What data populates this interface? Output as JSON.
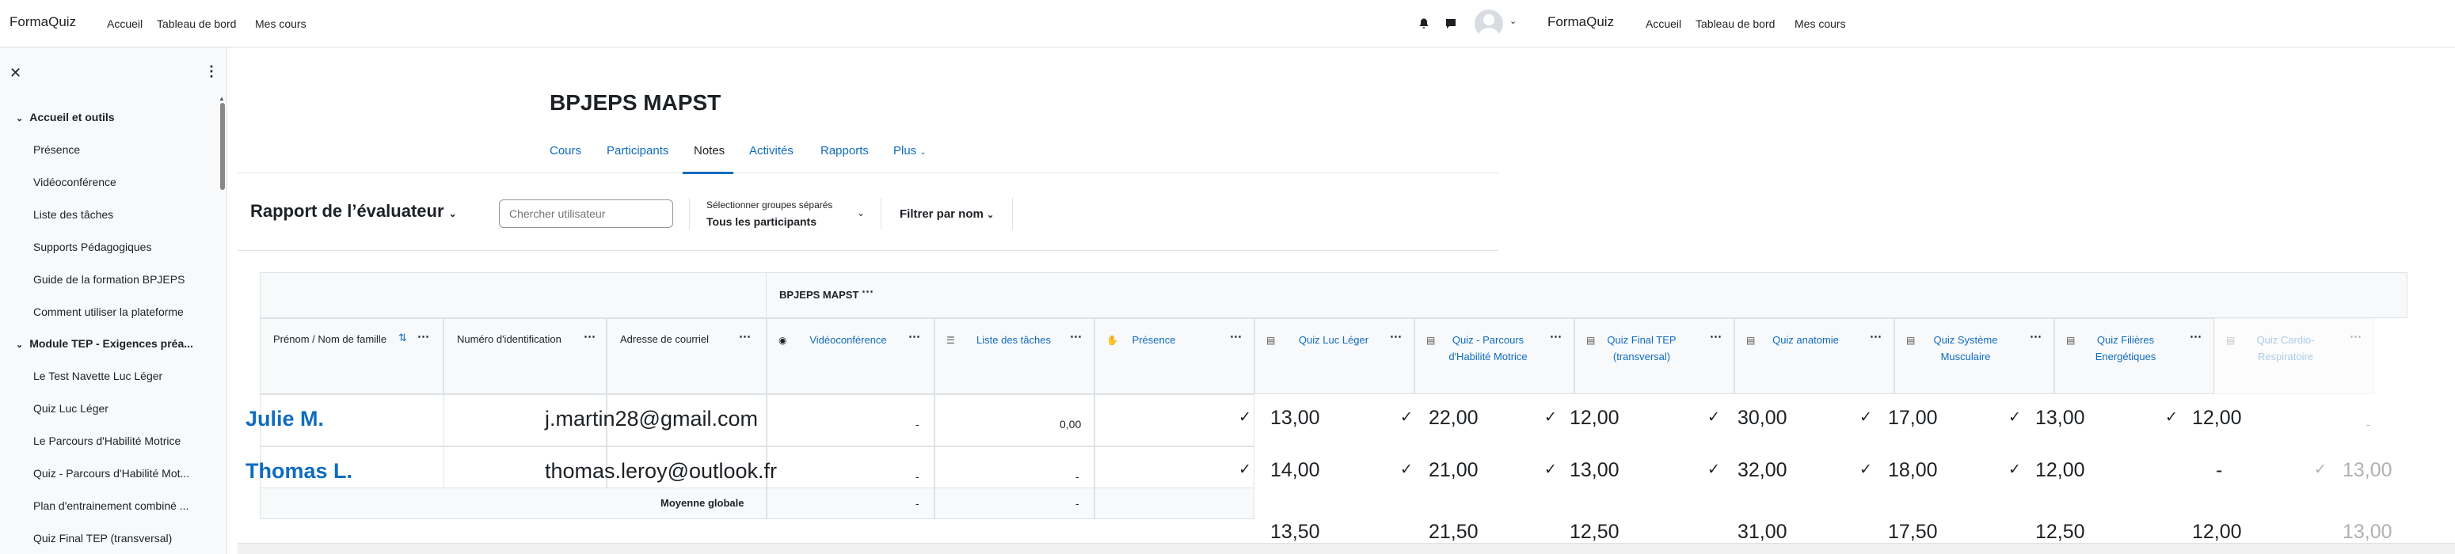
{
  "topbar": {
    "brand_left": "FormaQuiz",
    "links_left": [
      "Accueil",
      "Tableau de bord",
      "Mes cours"
    ],
    "brand_right": "FormaQuiz",
    "links_right": [
      "Accueil",
      "Tableau de bord",
      "Mes cours"
    ]
  },
  "drawer": {
    "sections": [
      {
        "label": "Accueil et outils",
        "items": [
          "Présence",
          "Vidéoconférence",
          "Liste des tâches",
          "Supports Pédagogiques",
          "Guide de la formation BPJEPS",
          "Comment utiliser la plateforme"
        ]
      },
      {
        "label": "Module TEP - Exigences préa...",
        "items": [
          "Le Test Navette Luc Léger",
          "Quiz Luc Léger",
          "Le Parcours d'Habilité Motrice",
          "Quiz - Parcours d'Habilité Mot...",
          "Plan d'entrainement combiné ...",
          "Quiz Final TEP (transversal)"
        ]
      }
    ]
  },
  "course": {
    "title": "BPJEPS MAPST",
    "tabs": [
      "Cours",
      "Participants",
      "Notes",
      "Activités",
      "Rapports",
      "Plus"
    ],
    "active_tab": "Notes"
  },
  "actionbar": {
    "report_title": "Rapport de l’évaluateur",
    "search_placeholder": "Chercher utilisateur",
    "group_label": "Sélectionner groupes séparés",
    "group_value": "Tous les participants",
    "filter_label": "Filtrer par nom"
  },
  "grades_table": {
    "category": "BPJEPS MAPST",
    "headers": {
      "name": "Prénom / Nom de famille",
      "idnumber": "Numéro d'identification",
      "email": "Adresse de courriel"
    },
    "items": [
      "Vidéoconférence",
      "Liste des tâches",
      "Présence",
      "Quiz Luc Léger",
      "Quiz - Parcours d'Habilité Motrice",
      "Quiz Final TEP (transversal)",
      "Quiz anatomie",
      "Quiz Système Musculaire",
      "Quiz Filières Energétiques",
      "Quiz Cardio-Respiratoire"
    ],
    "rows": [
      {
        "name": "Julie M.",
        "email": "j.martin28@gmail.com",
        "visio": "-",
        "taches": "0,00",
        "grades": [
          "13,00",
          "22,00",
          "12,00",
          "30,00",
          "17,00",
          "13,00",
          "12,00"
        ],
        "last": "-"
      },
      {
        "name": "Thomas L.",
        "email": "thomas.leroy@outlook.fr",
        "visio": "-",
        "taches": "-",
        "grades": [
          "14,00",
          "21,00",
          "13,00",
          "32,00",
          "18,00",
          "12,00",
          "-"
        ],
        "last": "13,00"
      }
    ],
    "average": {
      "label": "Moyenne globale",
      "visio": "-",
      "taches": "-",
      "values": [
        "13,50",
        "21,50",
        "12,50",
        "31,00",
        "17,50",
        "12,50",
        "12,00"
      ],
      "last": "13,00"
    }
  }
}
